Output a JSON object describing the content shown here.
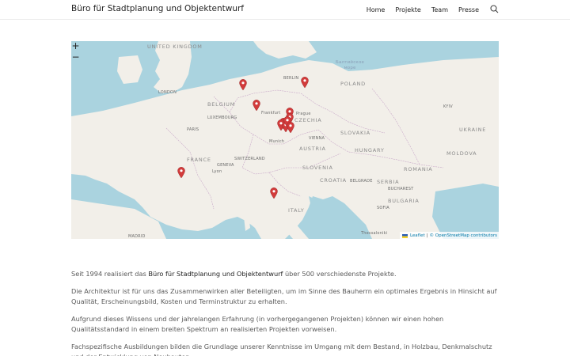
{
  "header": {
    "site_title": "Büro für Stadtplanung und Objektentwurf",
    "nav": [
      "Home",
      "Projekte",
      "Team",
      "Presse"
    ]
  },
  "map": {
    "zoom_in": "+",
    "zoom_out": "−",
    "labels": {
      "united_kingdom": "UNITED KINGDOM",
      "london": "LONDON",
      "belgium": "BELGIUM",
      "luxembourg": "LUXEMBOURG",
      "paris": "PARIS",
      "france": "FRANCE",
      "geneva": "GENEVA",
      "lyon": "Lyon",
      "switzerland": "SWITZERLAND",
      "frankfurt": "Frankfurt",
      "berlin": "BERLIN",
      "poland": "POLAND",
      "prague": "Prague",
      "czechia": "CZECHIA",
      "munich": "Munich",
      "vienna": "VIENNA",
      "austria": "AUSTRIA",
      "slovakia": "SLOVAKIA",
      "hungary": "HUNGARY",
      "slovenia": "SLOVENIA",
      "croatia": "CROATIA",
      "italy": "ITALY",
      "kyiv": "KYIV",
      "ukraine": "UKRAINE",
      "moldova": "MOLDOVA",
      "romania": "ROMANIA",
      "bulgaria": "BULGARIA",
      "serbia": "SERBIA",
      "belgrade": "BELGRADE",
      "bucharest": "BUCHAREST",
      "sofia": "SOFIA",
      "madrid": "MADRID",
      "baltic_sea": "Балтийское\nморе",
      "thessaloniki": "Thessaloniki"
    },
    "attribution": {
      "leaflet": "Leaflet",
      "separator": "|",
      "osm": "© OpenStreetMap contributors"
    },
    "marker_color": "#d23b3b"
  },
  "content": {
    "p1_before": "Seit 1994 realisiert das ",
    "p1_highlight": "Büro für Stadtplanung und Objektentwurf",
    "p1_after": " über 500 verschiedenste Projekte.",
    "p2": "Die Architektur ist für uns das Zusammenwirken aller Beteiligten, um im Sinne des Bauherrn ein optimales Ergebnis in Hinsicht auf Qualität, Erscheinungsbild, Kosten und Terminstruktur zu erhalten.",
    "p3": "Aufgrund dieses Wissens und der jahrelangen Erfahrung (in vorhergegangenen Projekten) können wir einen hohen Qualitätsstandard in einem breiten Spektrum an realisierten Projekten vorweisen.",
    "p4": "Fachspezifische Ausbildungen bilden die Grundlage unserer Kenntnisse im Umgang mit dem Bestand, in Holzbau, Denkmalschutz und der Entwicklung von Neubauten."
  }
}
